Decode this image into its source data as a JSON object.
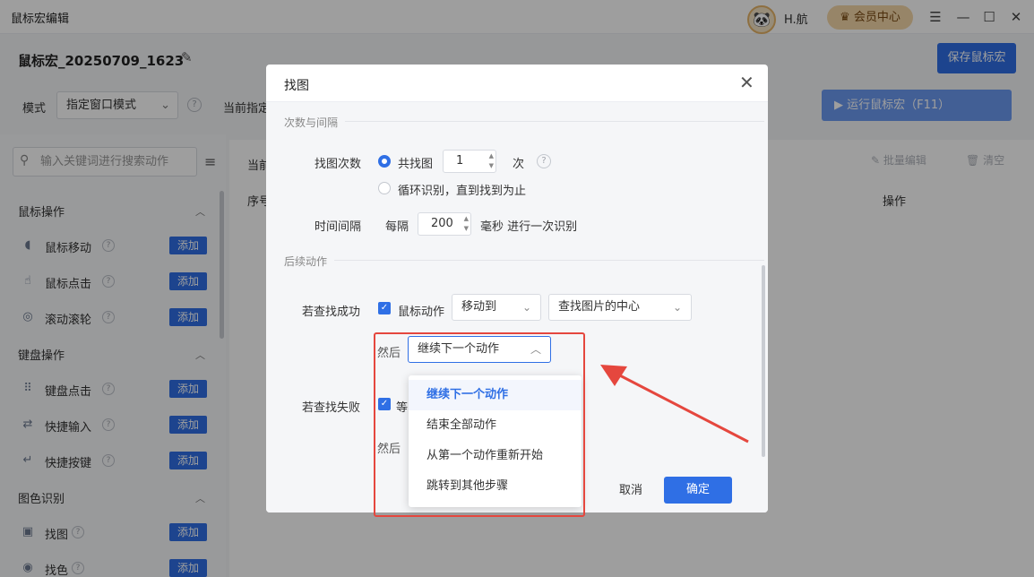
{
  "app": {
    "title": "鼠标宏编辑",
    "username": "H.航",
    "member_center": "会员中心",
    "window_controls": [
      "menu-icon",
      "minimize-icon",
      "maximize-icon",
      "close-icon"
    ]
  },
  "header": {
    "macro_name": "鼠标宏_20250709_1623",
    "save_label": "保存鼠标宏",
    "mode_label": "模式",
    "mode_value": "指定窗口模式",
    "current_label": "当前指定",
    "run_label": "▶ 运行鼠标宏（F11）"
  },
  "sidebar": {
    "search_placeholder": "输入关键词进行搜索动作",
    "add_label": "添加",
    "categories": [
      {
        "label": "鼠标操作",
        "items": [
          {
            "label": "鼠标移动",
            "icon": "mouse-icon"
          },
          {
            "label": "鼠标点击",
            "icon": "click-icon"
          },
          {
            "label": "滚动滚轮",
            "icon": "scroll-icon"
          }
        ]
      },
      {
        "label": "键盘操作",
        "items": [
          {
            "label": "键盘点击",
            "icon": "keyboard-icon"
          },
          {
            "label": "快捷输入",
            "icon": "input-icon"
          },
          {
            "label": "快捷按键",
            "icon": "enter-key-icon"
          }
        ]
      },
      {
        "label": "图色识别",
        "items": [
          {
            "label": "找图",
            "icon": "image-icon"
          },
          {
            "label": "找色",
            "icon": "color-icon"
          }
        ]
      }
    ]
  },
  "main": {
    "current_label": "当前",
    "batch_edit": "批量编辑",
    "clear": "清空",
    "col_seq": "序号",
    "col_op": "操作"
  },
  "dialog": {
    "title": "找图",
    "section_count": "次数与间隔",
    "find_count_label": "找图次数",
    "radio_total": "共找图",
    "count_value": "1",
    "count_unit": "次",
    "radio_loop": "循环识别，直到找到为止",
    "interval_label": "时间间隔",
    "interval_prefix": "每隔",
    "interval_value": "200",
    "interval_suffix": "毫秒 进行一次识别",
    "section_follow": "后续动作",
    "success_label": "若查找成功",
    "mouse_action": "鼠标动作",
    "move_to": "移动到",
    "target": "查找图片的中心",
    "then": "然后",
    "then_value": "继续下一个动作",
    "fail_label": "若查找失败",
    "fail_action": "等",
    "then2": "然后",
    "cancel": "取消",
    "confirm": "确定"
  },
  "dropdown": {
    "options": [
      "继续下一个动作",
      "结束全部动作",
      "从第一个动作重新开始",
      "跳转到其他步骤"
    ],
    "selected_index": 0
  },
  "colors": {
    "accent": "#2f6fe5",
    "annotation": "#e5473e"
  }
}
